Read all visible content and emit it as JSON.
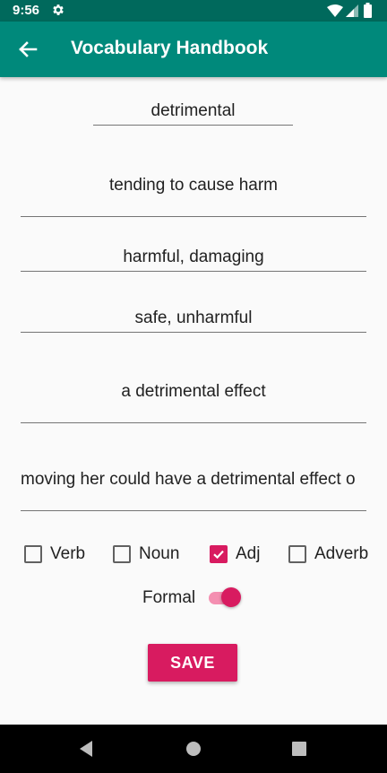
{
  "status_bar": {
    "time": "9:56",
    "icons": [
      "gear-icon",
      "wifi-icon",
      "signal-icon",
      "battery-icon"
    ]
  },
  "app_bar": {
    "title": "Vocabulary Handbook",
    "back_icon": "arrow-back-icon"
  },
  "fields": {
    "word": "detrimental",
    "definition": "tending to cause harm",
    "synonyms": "harmful, damaging",
    "antonyms": "safe, unharmful",
    "collocation": "a detrimental effect",
    "example": "moving her could have a detrimental effect o"
  },
  "parts_of_speech": [
    {
      "label": "Verb",
      "checked": false
    },
    {
      "label": "Noun",
      "checked": false
    },
    {
      "label": "Adj",
      "checked": true
    },
    {
      "label": "Adverb",
      "checked": false
    }
  ],
  "formal": {
    "label": "Formal",
    "on": true
  },
  "save_label": "SAVE",
  "colors": {
    "status_bar": "#00695c",
    "app_bar": "#00897b",
    "accent": "#d81b60",
    "switch_track": "#f48fb1"
  },
  "nav_bar": {
    "icons": [
      "back-triangle-icon",
      "home-circle-icon",
      "recents-square-icon"
    ]
  }
}
